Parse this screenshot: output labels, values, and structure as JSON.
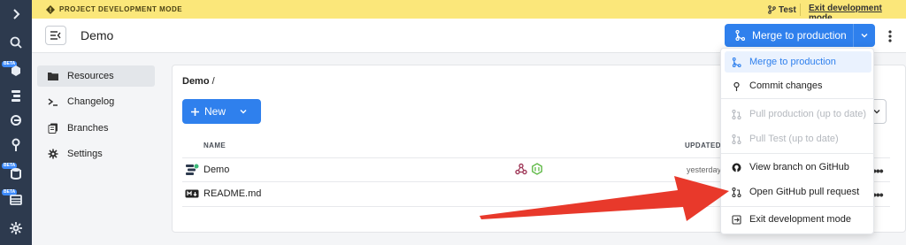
{
  "banner": {
    "mode_label": "PROJECT DEVELOPMENT MODE",
    "branch_name": "Test",
    "exit_link": "Exit development mode",
    "bg_color": "#fbe77a"
  },
  "header": {
    "title": "Demo",
    "merge_button": "Merge to production",
    "accent_color": "#2f80ed"
  },
  "sidebar": {
    "items": [
      {
        "label": "Resources",
        "icon": "folder-icon",
        "active": true
      },
      {
        "label": "Changelog",
        "icon": "terminal-icon",
        "active": false
      },
      {
        "label": "Branches",
        "icon": "branches-icon",
        "active": false
      },
      {
        "label": "Settings",
        "icon": "gear-icon",
        "active": false
      }
    ]
  },
  "content": {
    "breadcrumb": "Demo",
    "breadcrumb_sep": "/",
    "new_button": "New",
    "columns": {
      "name": "NAME",
      "updated": "UPDATED"
    },
    "rows": [
      {
        "name": "Demo",
        "updated": "yesterday",
        "icon": "app-icon"
      },
      {
        "name": "README.md",
        "updated": "",
        "icon": "markdown-icon"
      }
    ]
  },
  "menu": {
    "items": [
      {
        "label": "Merge to production",
        "state": "highlighted",
        "icon": "merge-icon"
      },
      {
        "label": "Commit changes",
        "state": "enabled",
        "icon": "commit-icon"
      },
      {
        "label": "Pull production (up to date)",
        "state": "disabled",
        "icon": "pull-request-icon"
      },
      {
        "label": "Pull Test (up to date)",
        "state": "disabled",
        "icon": "pull-request-icon"
      },
      {
        "label": "View branch on GitHub",
        "state": "enabled",
        "icon": "github-icon"
      },
      {
        "label": "Open GitHub pull request",
        "state": "enabled",
        "icon": "pull-request-icon"
      },
      {
        "label": "Exit development mode",
        "state": "enabled",
        "icon": "exit-icon"
      }
    ]
  },
  "rail": {
    "icons": [
      "chevron-right-icon",
      "search-icon",
      "apps-icon",
      "workflows-icon",
      "resources-icon",
      "keys-icon",
      "database-icon",
      "tables-icon",
      "settings-icon"
    ],
    "beta_label": "BETA"
  }
}
